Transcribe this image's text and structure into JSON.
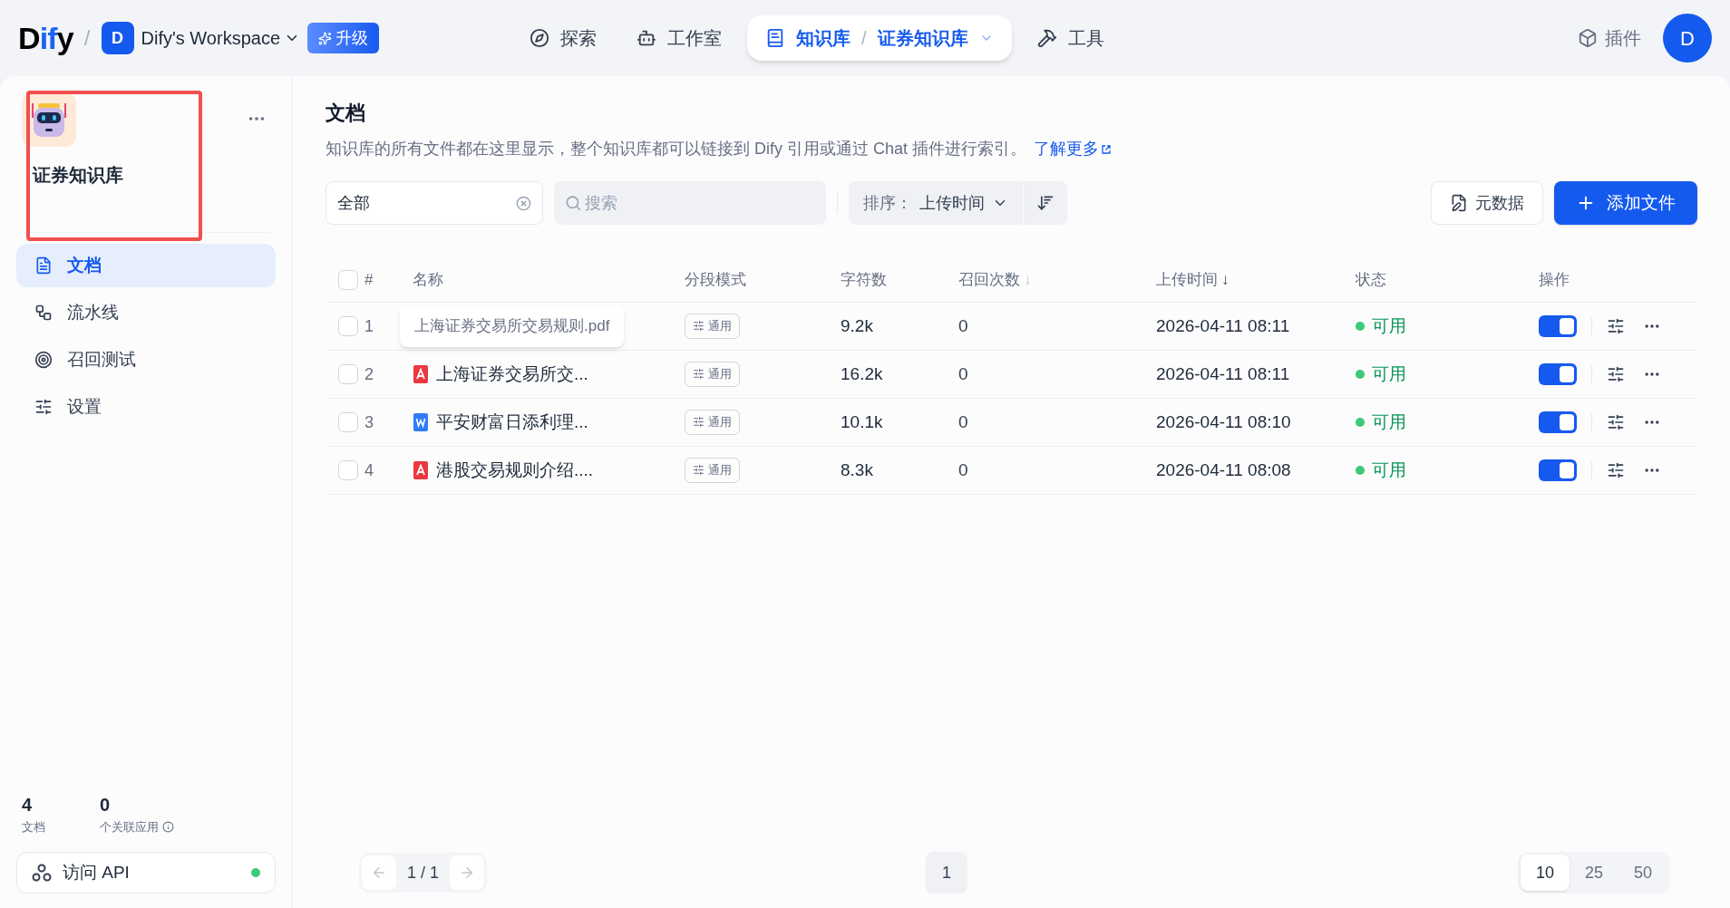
{
  "topbar": {
    "logo": {
      "plain": "D",
      "accent": "if",
      "tail": "y"
    },
    "separator": "/",
    "workspace": {
      "initial": "D",
      "name": "Dify's Workspace"
    },
    "upgrade": "升级",
    "nav": [
      {
        "label": "探索",
        "selected": false
      },
      {
        "label": "工作室",
        "selected": false
      },
      {
        "label": "知识库",
        "selected": true,
        "separator": "/",
        "sub": "证券知识库"
      },
      {
        "label": "工具",
        "selected": false
      }
    ],
    "plugins": "插件",
    "avatar": "D"
  },
  "sidebar": {
    "title": "证券知识库",
    "highlight_box": true,
    "items": [
      {
        "label": "文档",
        "selected": true
      },
      {
        "label": "流水线",
        "selected": false
      },
      {
        "label": "召回测试",
        "selected": false
      },
      {
        "label": "设置",
        "selected": false
      }
    ],
    "stats": [
      {
        "value": "4",
        "label": "文档"
      },
      {
        "value": "0",
        "label": "个关联应用"
      }
    ],
    "api": {
      "label": "访问 API",
      "color": "#3cca7a"
    }
  },
  "main": {
    "title": "文档",
    "description": "知识库的所有文件都在这里显示，整个知识库都可以链接到 Dify 引用或通过 Chat 插件进行索引。",
    "learn_more": "了解更多",
    "filter": {
      "value": "全部"
    },
    "search": {
      "placeholder": "搜索"
    },
    "sort": {
      "label": "排序：",
      "value": "上传时间"
    },
    "metadata_button": "元数据",
    "add_button": "添加文件",
    "table": {
      "select_all_checked": false,
      "columns": [
        {
          "label": "#"
        },
        {
          "label": "名称"
        },
        {
          "label": "分段模式"
        },
        {
          "label": "字符数"
        },
        {
          "label": "召回次数",
          "arrow": "↓",
          "sorted": false
        },
        {
          "label": "上传时间",
          "arrow": "↓",
          "sorted": true
        },
        {
          "label": "状态"
        },
        {
          "label": "操作"
        }
      ],
      "rows": [
        {
          "index": "1",
          "tooltip": "上海证券交易所交易规则.pdf",
          "mode": "通用",
          "chars": "9.2k",
          "recalls": "0",
          "uploaded": "2026-04-11 08:11",
          "status": "可用",
          "color": "#3cca7a",
          "checked": false,
          "enabled": true
        },
        {
          "index": "2",
          "kind": "pdf",
          "name": "上海证券交易所交...",
          "mode": "通用",
          "chars": "16.2k",
          "recalls": "0",
          "uploaded": "2026-04-11 08:11",
          "status": "可用",
          "color": "#3cca7a",
          "checked": false,
          "enabled": true
        },
        {
          "index": "3",
          "kind": "word",
          "name": "平安财富日添利理...",
          "mode": "通用",
          "chars": "10.1k",
          "recalls": "0",
          "uploaded": "2026-04-11 08:10",
          "status": "可用",
          "color": "#3cca7a",
          "checked": false,
          "enabled": true
        },
        {
          "index": "4",
          "kind": "pdf",
          "name": "港股交易规则介绍....",
          "mode": "通用",
          "chars": "8.3k",
          "recalls": "0",
          "uploaded": "2026-04-11 08:08",
          "status": "可用",
          "color": "#3cca7a",
          "checked": false,
          "enabled": true
        }
      ]
    },
    "pagination": {
      "pages": "1 / 1",
      "current": "1",
      "sizes": [
        {
          "label": "10",
          "selected": true
        },
        {
          "label": "25",
          "selected": false
        },
        {
          "label": "50",
          "selected": false
        }
      ]
    }
  }
}
